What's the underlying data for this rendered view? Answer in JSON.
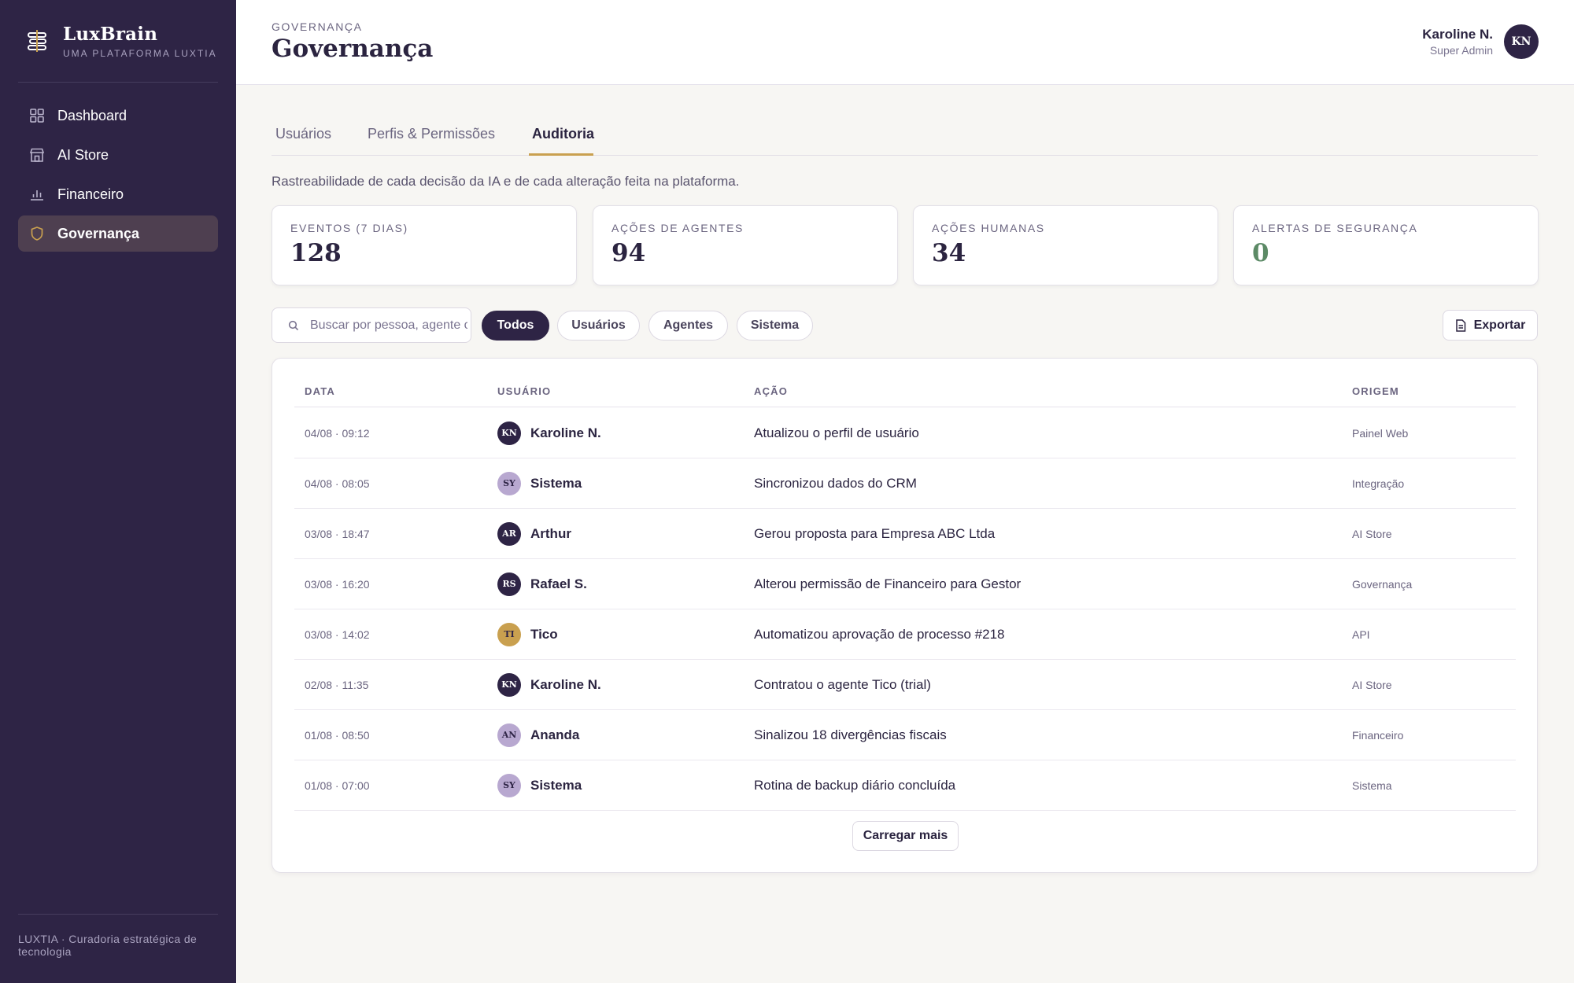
{
  "brand": {
    "name": "LuxBrain",
    "subtitle": "UMA PLATAFORMA LUXTIA"
  },
  "sidebar": {
    "items": [
      {
        "label": "Dashboard",
        "icon": "grid-icon"
      },
      {
        "label": "AI Store",
        "icon": "store-icon"
      },
      {
        "label": "Financeiro",
        "icon": "bar-chart-icon"
      },
      {
        "label": "Governança",
        "icon": "shield-icon",
        "active": true
      }
    ],
    "footer": "LUXTIA · Curadoria estratégica de tecnologia"
  },
  "header": {
    "breadcrumb": "GOVERNANÇA",
    "title": "Governança",
    "user": {
      "name": "Karoline N.",
      "role": "Super Admin",
      "initials": "KN"
    }
  },
  "tabs": [
    {
      "label": "Usuários"
    },
    {
      "label": "Perfis & Permissões"
    },
    {
      "label": "Auditoria",
      "active": true
    }
  ],
  "description": "Rastreabilidade de cada decisão da IA e de cada alteração feita na plataforma.",
  "stats": [
    {
      "label": "EVENTOS (7 DIAS)",
      "value": "128"
    },
    {
      "label": "AÇÕES DE AGENTES",
      "value": "94"
    },
    {
      "label": "AÇÕES HUMANAS",
      "value": "34"
    },
    {
      "label": "ALERTAS DE SEGURANÇA",
      "value": "0"
    }
  ],
  "filters": {
    "search_placeholder": "Buscar por pessoa, agente ou ação",
    "chips": [
      "Todos",
      "Usuários",
      "Agentes",
      "Sistema"
    ],
    "active_chip": "Todos",
    "export_label": "Exportar"
  },
  "table": {
    "headers": [
      "DATA",
      "USUÁRIO",
      "AÇÃO",
      "ORIGEM"
    ],
    "rows": [
      {
        "date": "04/08 · 09:12",
        "initials": "KN",
        "user": "Karoline N.",
        "action": "Atualizou o perfil de usuário",
        "origin": "Painel Web"
      },
      {
        "date": "04/08 · 08:05",
        "initials": "SY",
        "user": "Sistema",
        "action": "Sincronizou dados do CRM",
        "origin": "Integração"
      },
      {
        "date": "03/08 · 18:47",
        "initials": "AR",
        "user": "Arthur",
        "action": "Gerou proposta para Empresa ABC Ltda",
        "origin": "AI Store"
      },
      {
        "date": "03/08 · 16:20",
        "initials": "RS",
        "user": "Rafael S.",
        "action": "Alterou permissão de Financeiro para Gestor",
        "origin": "Governança"
      },
      {
        "date": "03/08 · 14:02",
        "initials": "TI",
        "user": "Tico",
        "action": "Automatizou aprovação de processo #218",
        "origin": "API"
      },
      {
        "date": "02/08 · 11:35",
        "initials": "KN",
        "user": "Karoline N.",
        "action": "Contratou o agente Tico (trial)",
        "origin": "AI Store"
      },
      {
        "date": "01/08 · 08:50",
        "initials": "AN",
        "user": "Ananda",
        "action": "Sinalizou 18 divergências fiscais",
        "origin": "Financeiro"
      },
      {
        "date": "01/08 · 07:00",
        "initials": "SY",
        "user": "Sistema",
        "action": "Rotina de backup diário concluída",
        "origin": "Sistema"
      }
    ],
    "load_more": "Carregar mais"
  },
  "colors": {
    "sidebar_bg": "#2e2445",
    "accent_gold": "#c9a04f",
    "avatar_dark": "#2e2445",
    "avatar_lilac": "#b8a8d0",
    "avatar_gold": "#c9a04f",
    "success_green": "#5c8a66"
  }
}
